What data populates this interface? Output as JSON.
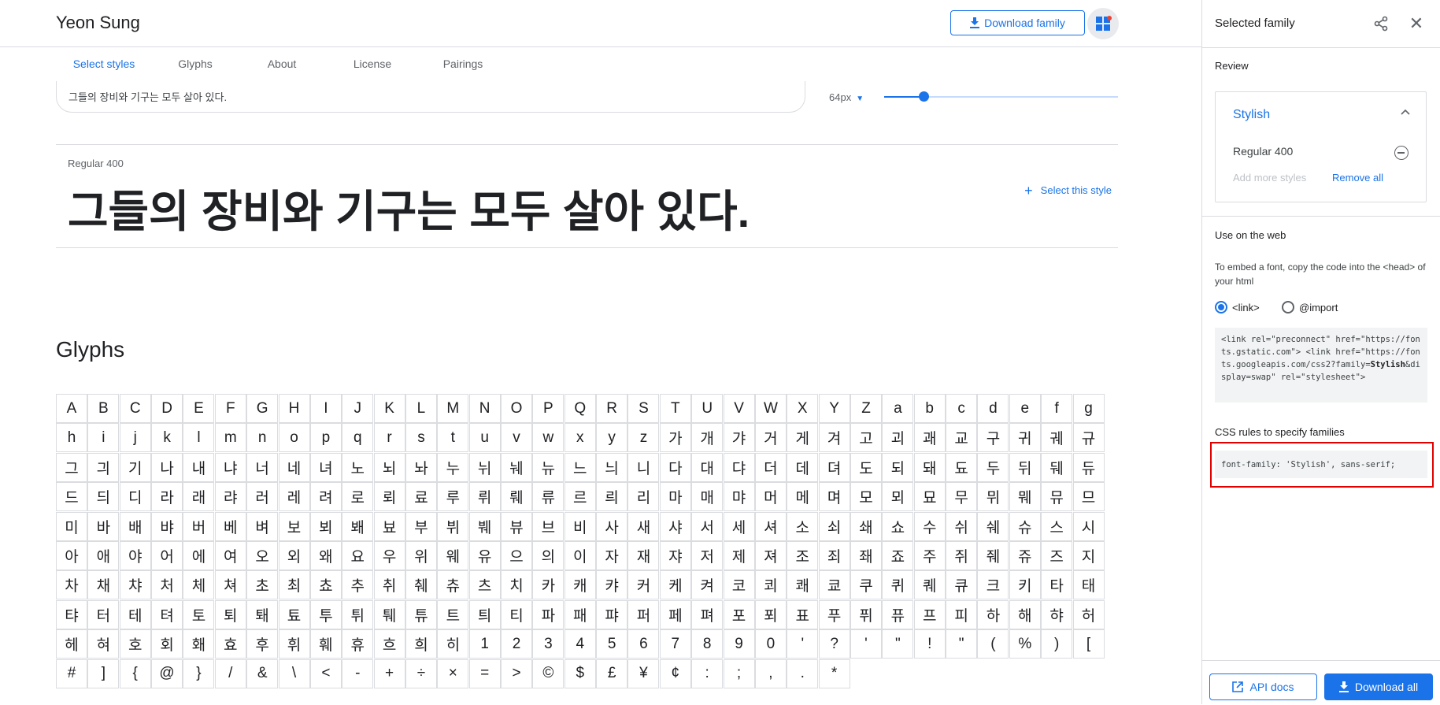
{
  "header": {
    "family_title": "Yeon Sung",
    "download_family_label": "Download family",
    "download_icon": "download-icon",
    "selection_icon": "font-selection-icon"
  },
  "tabs": [
    {
      "label": "Select styles",
      "active": true
    },
    {
      "label": "Glyphs",
      "active": false
    },
    {
      "label": "About",
      "active": false
    },
    {
      "label": "License",
      "active": false
    },
    {
      "label": "Pairings",
      "active": false
    }
  ],
  "preview": {
    "text": "그들의 장비와 기구는 모두 살아 있다.",
    "size_label": "64px",
    "size_fraction": 0.17
  },
  "style_row": {
    "name": "Regular 400",
    "sample": "그들의 장비와 기구는 모두 살아 있다.",
    "select_label": "Select this style"
  },
  "glyphs": {
    "heading": "Glyphs",
    "items": [
      "A",
      "B",
      "C",
      "D",
      "E",
      "F",
      "G",
      "H",
      "I",
      "J",
      "K",
      "L",
      "M",
      "N",
      "O",
      "P",
      "Q",
      "R",
      "S",
      "T",
      "U",
      "V",
      "W",
      "X",
      "Y",
      "Z",
      "a",
      "b",
      "c",
      "d",
      "e",
      "f",
      "g",
      "h",
      "i",
      "j",
      "k",
      "l",
      "m",
      "n",
      "o",
      "p",
      "q",
      "r",
      "s",
      "t",
      "u",
      "v",
      "w",
      "x",
      "y",
      "z",
      "가",
      "개",
      "갸",
      "거",
      "게",
      "겨",
      "고",
      "괴",
      "괘",
      "교",
      "구",
      "귀",
      "궤",
      "규",
      "그",
      "긔",
      "기",
      "나",
      "내",
      "냐",
      "너",
      "네",
      "녀",
      "노",
      "뇌",
      "놔",
      "누",
      "뉘",
      "눼",
      "뉴",
      "느",
      "늬",
      "니",
      "다",
      "대",
      "댜",
      "더",
      "데",
      "뎌",
      "도",
      "되",
      "돼",
      "됴",
      "두",
      "뒤",
      "뒈",
      "듀",
      "드",
      "듸",
      "디",
      "라",
      "래",
      "랴",
      "러",
      "레",
      "려",
      "로",
      "뢰",
      "료",
      "루",
      "뤼",
      "뤠",
      "류",
      "르",
      "릐",
      "리",
      "마",
      "매",
      "먀",
      "머",
      "메",
      "며",
      "모",
      "뫼",
      "묘",
      "무",
      "뮈",
      "뭬",
      "뮤",
      "므",
      "미",
      "바",
      "배",
      "뱌",
      "버",
      "베",
      "벼",
      "보",
      "뵈",
      "봬",
      "뵤",
      "부",
      "뷔",
      "붸",
      "뷰",
      "브",
      "비",
      "사",
      "새",
      "샤",
      "서",
      "세",
      "셔",
      "소",
      "쇠",
      "쇄",
      "쇼",
      "수",
      "쉬",
      "쉐",
      "슈",
      "스",
      "시",
      "아",
      "애",
      "야",
      "어",
      "에",
      "여",
      "오",
      "외",
      "왜",
      "요",
      "우",
      "위",
      "웨",
      "유",
      "으",
      "의",
      "이",
      "자",
      "재",
      "쟈",
      "저",
      "제",
      "져",
      "조",
      "죄",
      "좨",
      "죠",
      "주",
      "쥐",
      "줴",
      "쥬",
      "즈",
      "지",
      "차",
      "채",
      "챠",
      "처",
      "체",
      "쳐",
      "초",
      "최",
      "쵸",
      "추",
      "취",
      "췌",
      "츄",
      "츠",
      "치",
      "카",
      "캐",
      "캬",
      "커",
      "케",
      "켜",
      "코",
      "쾨",
      "쾌",
      "쿄",
      "쿠",
      "퀴",
      "퀘",
      "큐",
      "크",
      "키",
      "타",
      "태",
      "탸",
      "터",
      "테",
      "텨",
      "토",
      "퇴",
      "퇘",
      "툐",
      "투",
      "튀",
      "퉤",
      "튜",
      "트",
      "틔",
      "티",
      "파",
      "패",
      "퍄",
      "퍼",
      "페",
      "펴",
      "포",
      "푀",
      "표",
      "푸",
      "퓌",
      "퓨",
      "프",
      "피",
      "하",
      "해",
      "햐",
      "허",
      "헤",
      "혀",
      "호",
      "회",
      "홰",
      "효",
      "후",
      "휘",
      "훼",
      "휴",
      "흐",
      "희",
      "히",
      "1",
      "2",
      "3",
      "4",
      "5",
      "6",
      "7",
      "8",
      "9",
      "0",
      "'",
      "?",
      "'",
      "\"",
      "!",
      "\"",
      "(",
      "%",
      ")",
      "[",
      "#",
      "]",
      "{",
      "@",
      "}",
      "/",
      "&",
      "\\",
      "<",
      "-",
      "+",
      "÷",
      "×",
      "=",
      ">",
      "©",
      "$",
      "£",
      "¥",
      "¢",
      ":",
      ";",
      ",",
      ".",
      "*"
    ]
  },
  "panel": {
    "title": "Selected family",
    "share_icon": "share-icon",
    "close_icon": "close-icon",
    "review_label": "Review",
    "family_name": "Stylish",
    "selected_style": "Regular 400",
    "add_more_label": "Add more styles",
    "remove_all_label": "Remove all",
    "web_label": "Use on the web",
    "embed_desc": "To embed a font, copy the code into the <head> of your html",
    "radio_link": "<link>",
    "radio_import": "@import",
    "selected_embed": "link",
    "code_pre": "<link rel=\"preconnect\" href=\"https://fonts.gstatic.com\">\n<link href=\"https://fonts.googleapis.com/css2?family=",
    "code_family": "Stylish",
    "code_post": "&display=swap\" rel=\"stylesheet\">",
    "css_label": "CSS rules to specify families",
    "css_rule": "font-family: 'Stylish', sans-serif;",
    "api_docs_label": "API docs",
    "download_all_label": "Download all"
  },
  "colors": {
    "accent": "#1a73e8",
    "highlight": "#e00000"
  }
}
